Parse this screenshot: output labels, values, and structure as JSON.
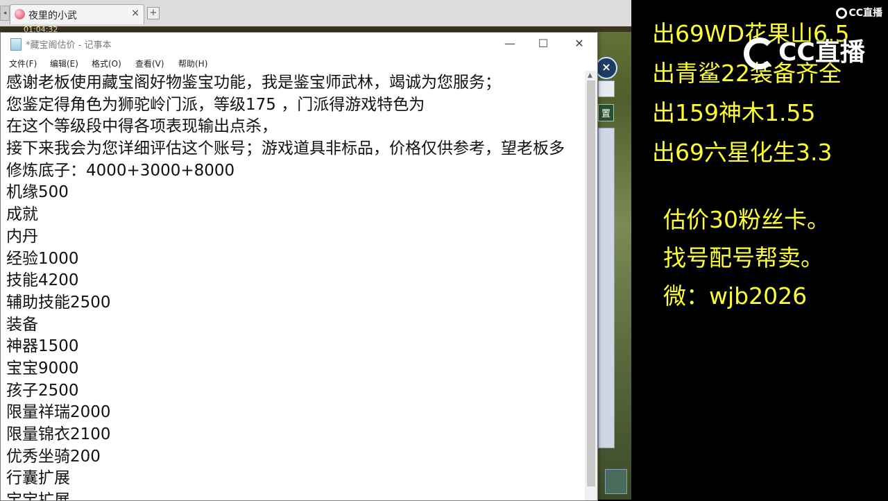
{
  "browser": {
    "tab_title": "夜里的小武",
    "tab_close": "×",
    "new_tab": "+",
    "game_timer": "01:04:32"
  },
  "game_ui": {
    "close_btn": "×",
    "side_tag": "置"
  },
  "notepad": {
    "title": "*藏宝阁估价 - 记事本",
    "window_controls": {
      "minimize": "—",
      "maximize": "☐",
      "close": "✕"
    },
    "menu": [
      "文件(F)",
      "编辑(E)",
      "格式(O)",
      "查看(V)",
      "帮助(H)"
    ],
    "lines": [
      "感谢老板使用藏宝阁好物鉴宝功能，我是鉴宝师武林，竭诚为您服务；",
      "您鉴定得角色为狮驼岭门派，等级175 ，门派得游戏特色为",
      "在这个等级段中得各项表现输出点杀，",
      "接下来我会为您详细评估这个账号；游戏道具非标品，价格仅供参考，望老板多",
      "修炼底子：4000+3000+8000",
      "机缘500",
      "成就",
      "内丹",
      "经验1000",
      "技能4200",
      "辅助技能2500",
      "装备",
      "神器1500",
      "宝宝9000",
      "孩子2500",
      "限量祥瑞2000",
      "限量锦衣2100",
      "优秀坐骑200",
      "行囊扩展",
      "宝宝扩展"
    ]
  },
  "overlay": {
    "logo_small": "CC直播",
    "logo_big": "CC直播",
    "sales": [
      "出69WD花果山6.5",
      "出青鲨22装备齐全",
      "出159神木1.55",
      "出69六星化生3.3"
    ],
    "info": [
      "估价30粉丝卡。",
      "找号配号帮卖。",
      "微：wjb2026"
    ],
    "text_color": "#ffff33"
  }
}
